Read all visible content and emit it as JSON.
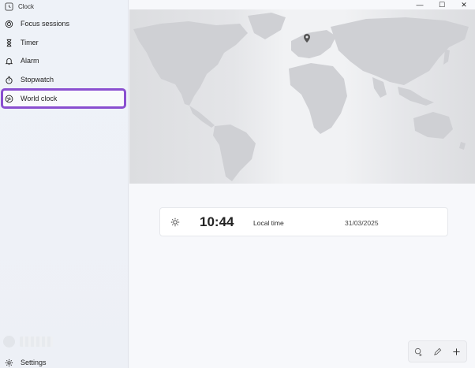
{
  "app": {
    "title": "Clock"
  },
  "nav": {
    "items": [
      {
        "label": "Focus sessions",
        "icon": "focus-icon"
      },
      {
        "label": "Timer",
        "icon": "hourglass-icon"
      },
      {
        "label": "Alarm",
        "icon": "bell-icon"
      },
      {
        "label": "Stopwatch",
        "icon": "stopwatch-icon"
      },
      {
        "label": "World clock",
        "icon": "globe-icon",
        "selected": true
      }
    ],
    "settings_label": "Settings"
  },
  "window_controls": {
    "minimize": "—",
    "maximize": "☐",
    "close": "✕"
  },
  "world_clock": {
    "card": {
      "icon": "sun-icon",
      "time": "10:44",
      "label": "Local time",
      "date": "31/03/2025"
    }
  },
  "toolbar": {
    "icons": [
      "compare-icon",
      "edit-icon",
      "add-icon"
    ]
  },
  "colors": {
    "selection_outline": "#8a4fd0",
    "map_land": "#d3d4d7",
    "map_water": "#e8e9ec"
  }
}
